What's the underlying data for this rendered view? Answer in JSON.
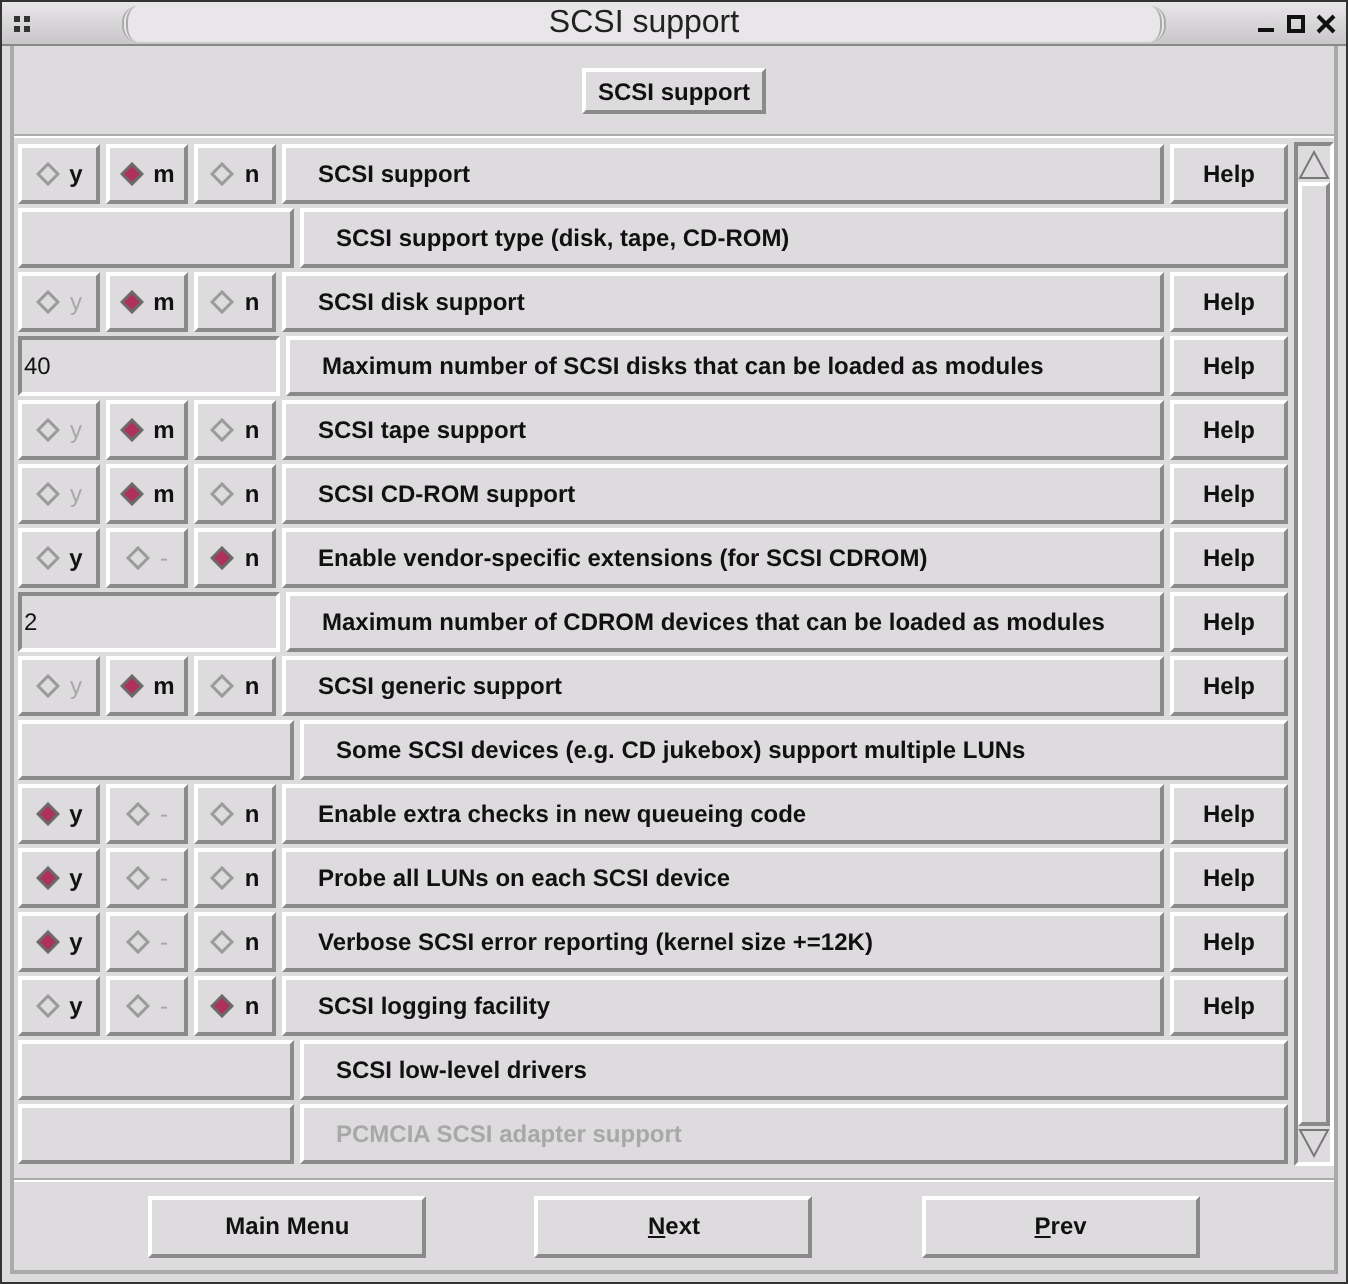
{
  "window": {
    "title": "SCSI support"
  },
  "header_button": "SCSI support",
  "rows": [
    {
      "kind": "tristate",
      "label": "SCSI support",
      "help": "Help",
      "options": [
        {
          "label": "y",
          "selected": false,
          "disabled": false
        },
        {
          "label": "m",
          "selected": true,
          "disabled": false
        },
        {
          "label": "n",
          "selected": false,
          "disabled": false
        }
      ]
    },
    {
      "kind": "comment",
      "label": "SCSI support type (disk, tape, CD-ROM)"
    },
    {
      "kind": "tristate",
      "label": "SCSI disk support",
      "help": "Help",
      "options": [
        {
          "label": "y",
          "selected": false,
          "disabled": true
        },
        {
          "label": "m",
          "selected": true,
          "disabled": false
        },
        {
          "label": "n",
          "selected": false,
          "disabled": false
        }
      ]
    },
    {
      "kind": "int",
      "value": "40",
      "label": "Maximum number of SCSI disks that can be loaded as modules",
      "help": "Help"
    },
    {
      "kind": "tristate",
      "label": "SCSI tape support",
      "help": "Help",
      "options": [
        {
          "label": "y",
          "selected": false,
          "disabled": true
        },
        {
          "label": "m",
          "selected": true,
          "disabled": false
        },
        {
          "label": "n",
          "selected": false,
          "disabled": false
        }
      ]
    },
    {
      "kind": "tristate",
      "label": "SCSI CD-ROM support",
      "help": "Help",
      "options": [
        {
          "label": "y",
          "selected": false,
          "disabled": true
        },
        {
          "label": "m",
          "selected": true,
          "disabled": false
        },
        {
          "label": "n",
          "selected": false,
          "disabled": false
        }
      ]
    },
    {
      "kind": "tristate",
      "label": "Enable vendor-specific extensions (for SCSI CDROM)",
      "help": "Help",
      "options": [
        {
          "label": "y",
          "selected": false,
          "disabled": false
        },
        {
          "label": "-",
          "selected": false,
          "disabled": true
        },
        {
          "label": "n",
          "selected": true,
          "disabled": false
        }
      ]
    },
    {
      "kind": "int",
      "value": "2",
      "label": "Maximum number of CDROM devices that can be loaded as modules",
      "help": "Help"
    },
    {
      "kind": "tristate",
      "label": "SCSI generic support",
      "help": "Help",
      "options": [
        {
          "label": "y",
          "selected": false,
          "disabled": true
        },
        {
          "label": "m",
          "selected": true,
          "disabled": false
        },
        {
          "label": "n",
          "selected": false,
          "disabled": false
        }
      ]
    },
    {
      "kind": "comment",
      "label": "Some SCSI devices (e.g. CD jukebox) support multiple LUNs"
    },
    {
      "kind": "tristate",
      "label": "Enable extra checks in new queueing code",
      "help": "Help",
      "options": [
        {
          "label": "y",
          "selected": true,
          "disabled": false
        },
        {
          "label": "-",
          "selected": false,
          "disabled": true
        },
        {
          "label": "n",
          "selected": false,
          "disabled": false
        }
      ]
    },
    {
      "kind": "tristate",
      "label": "Probe all LUNs on each SCSI device",
      "help": "Help",
      "options": [
        {
          "label": "y",
          "selected": true,
          "disabled": false
        },
        {
          "label": "-",
          "selected": false,
          "disabled": true
        },
        {
          "label": "n",
          "selected": false,
          "disabled": false
        }
      ]
    },
    {
      "kind": "tristate",
      "label": "Verbose SCSI error reporting (kernel size +=12K)",
      "help": "Help",
      "options": [
        {
          "label": "y",
          "selected": true,
          "disabled": false
        },
        {
          "label": "-",
          "selected": false,
          "disabled": true
        },
        {
          "label": "n",
          "selected": false,
          "disabled": false
        }
      ]
    },
    {
      "kind": "tristate",
      "label": "SCSI logging facility",
      "help": "Help",
      "options": [
        {
          "label": "y",
          "selected": false,
          "disabled": false
        },
        {
          "label": "-",
          "selected": false,
          "disabled": true
        },
        {
          "label": "n",
          "selected": true,
          "disabled": false
        }
      ]
    },
    {
      "kind": "submenu",
      "label": "SCSI low-level drivers",
      "disabled": false
    },
    {
      "kind": "submenu",
      "label": "PCMCIA SCSI adapter support",
      "disabled": true
    }
  ],
  "buttons": [
    {
      "label": "Main Menu",
      "mnemonic": false
    },
    {
      "label": "Next",
      "mnemonic": true
    },
    {
      "label": "Prev",
      "mnemonic": true
    }
  ]
}
